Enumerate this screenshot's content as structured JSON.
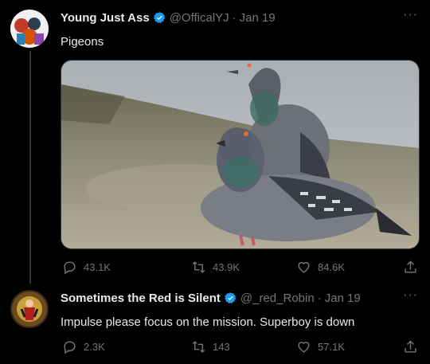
{
  "tweets": [
    {
      "display_name": "Young Just Ass",
      "handle": "@OfficalYJ",
      "separator": "·",
      "date": "Jan 19",
      "text": "Pigeons",
      "replies": "43.1K",
      "retweets": "43.9K",
      "likes": "84.6K",
      "media_icon": "pigeon-photo"
    },
    {
      "display_name": "Sometimes the Red is Silent",
      "handle": "@_red_Robin",
      "separator": "·",
      "date": "Jan 19",
      "text": "Impulse please focus on the mission. Superboy is down",
      "replies": "2.3K",
      "retweets": "143",
      "likes": "57.1K"
    }
  ],
  "more_label": "···",
  "colors": {
    "background": "#000000",
    "text": "#e7e9ea",
    "muted": "#71767b",
    "verified": "#1d9bf0"
  },
  "icons": [
    "reply-icon",
    "retweet-icon",
    "like-icon",
    "share-icon",
    "verified-badge-icon",
    "more-icon"
  ]
}
